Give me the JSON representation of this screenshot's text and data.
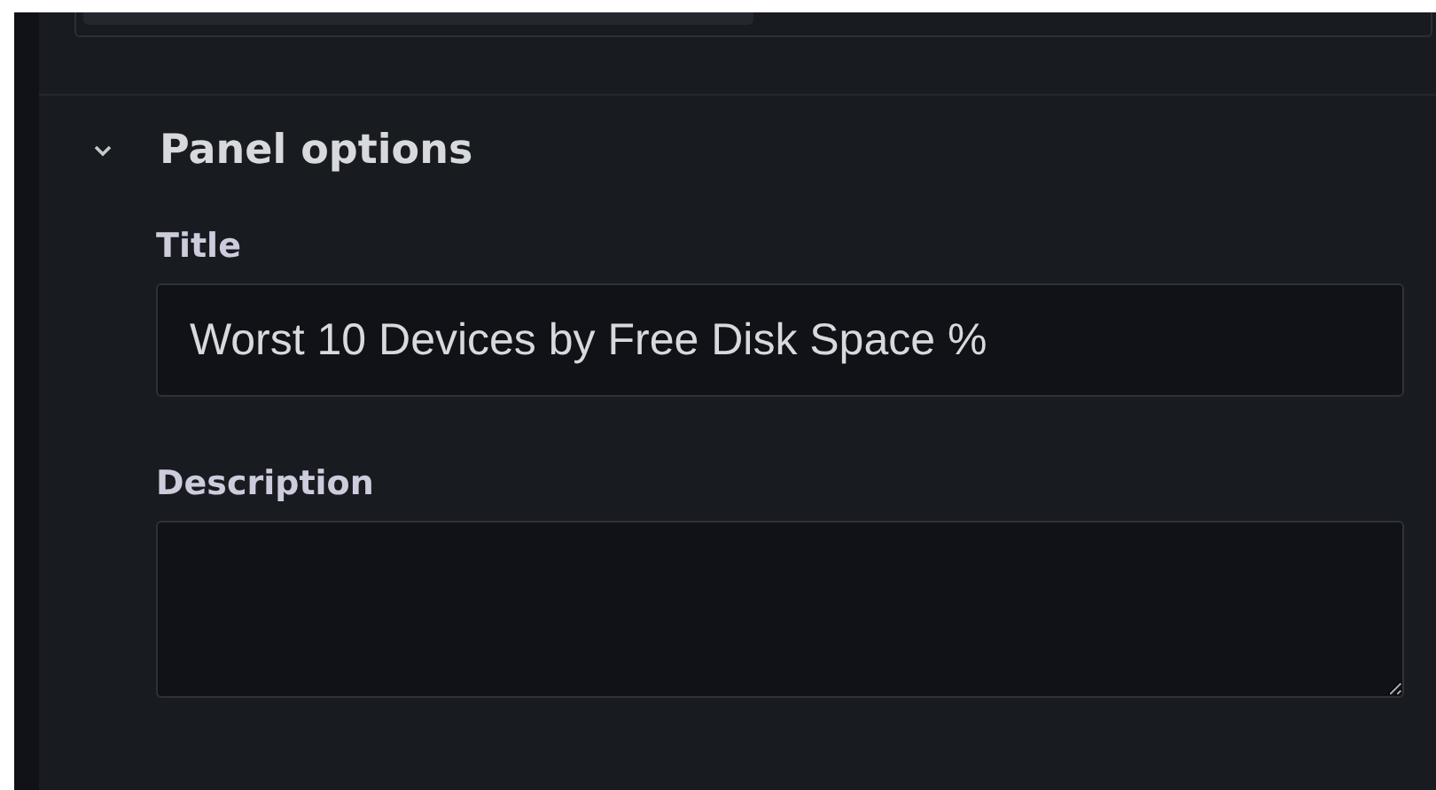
{
  "section": {
    "title": "Panel options",
    "expanded": true
  },
  "fields": [
    {
      "kind": "input",
      "label": "Title",
      "value": "Worst 10 Devices by Free Disk Space %"
    },
    {
      "kind": "textarea",
      "label": "Description"
    }
  ]
}
